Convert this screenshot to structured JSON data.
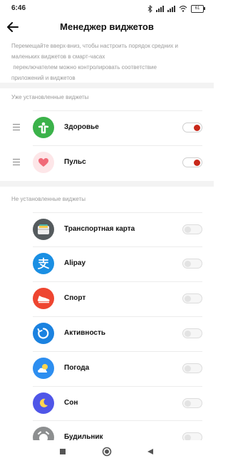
{
  "status_bar": {
    "time": "6:46",
    "battery": "61"
  },
  "header": {
    "title": "Менеджер виджетов"
  },
  "intro_lines": [
    "Перемещайте вверх-вниз, чтобы настроить порядок средних и",
    "маленьких виджетов в смарт-часах",
    " переключателем можно контролировать соответствие",
    "приложений и виджетов"
  ],
  "installed": {
    "label": "Уже установленные виджеты",
    "items": [
      {
        "name": "Здоровье",
        "icon": "health-icon",
        "enabled": true
      },
      {
        "name": "Пульс",
        "icon": "heart-icon",
        "enabled": true
      }
    ]
  },
  "not_installed": {
    "label": "Не установленные виджеты",
    "items": [
      {
        "name": "Транспортная карта",
        "icon": "wallet-icon",
        "enabled": false
      },
      {
        "name": "Alipay",
        "icon": "alipay-icon",
        "enabled": false
      },
      {
        "name": "Спорт",
        "icon": "sneaker-icon",
        "enabled": false
      },
      {
        "name": "Активность",
        "icon": "activity-icon",
        "enabled": false
      },
      {
        "name": "Погода",
        "icon": "weather-icon",
        "enabled": false
      },
      {
        "name": "Сон",
        "icon": "moon-icon",
        "enabled": false
      },
      {
        "name": "Будильник",
        "icon": "alarm-icon",
        "enabled": false
      }
    ]
  },
  "colors": {
    "toggle_on": "#c8281a",
    "health": "#3bb24a",
    "heart": "#f06a78",
    "alipay": "#1a8fe3",
    "sport": "#ee4530",
    "activity": "#1b82e0",
    "weather": "#2d8ef0",
    "sleep": "#4f56e8"
  }
}
